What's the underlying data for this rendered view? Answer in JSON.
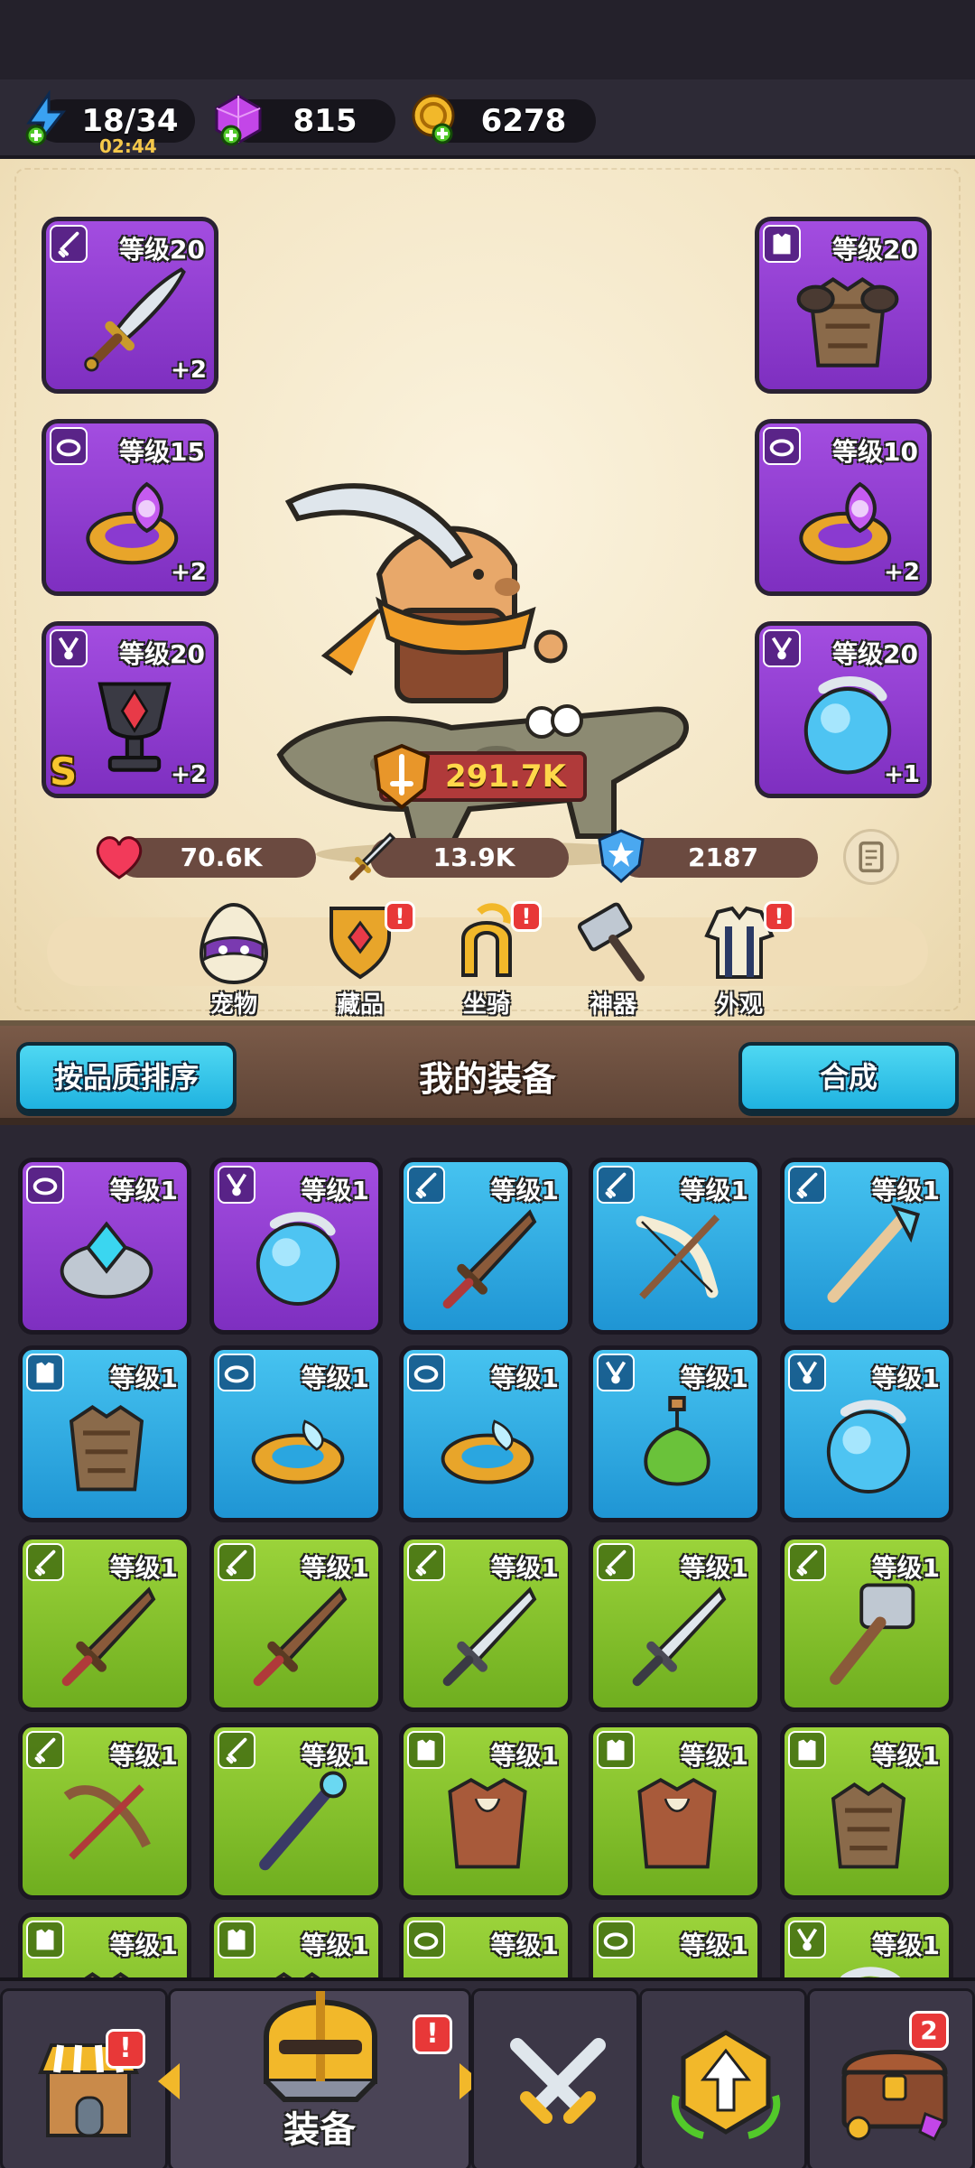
{
  "resources": {
    "energy": {
      "value": "18/34",
      "timer": "02:44",
      "icon": "lightning-plus-icon"
    },
    "gems": {
      "value": "815",
      "icon": "purple-gem-plus-icon"
    },
    "coins": {
      "value": "6278",
      "icon": "gold-coin-plus-icon"
    }
  },
  "equipped": {
    "weapon": {
      "level": "等级20",
      "plus": "+2",
      "quality": "purple",
      "icon": "sword-icon"
    },
    "armor": {
      "level": "等级20",
      "quality": "purple",
      "icon": "armor-icon"
    },
    "ring_left": {
      "level": "等级15",
      "plus": "+2",
      "quality": "purple",
      "icon": "ring-icon"
    },
    "ring_right": {
      "level": "等级10",
      "plus": "+2",
      "quality": "purple",
      "icon": "ring-icon"
    },
    "necklace": {
      "level": "等级20",
      "plus": "+2",
      "rank": "S",
      "quality": "purple",
      "icon": "chalice-icon"
    },
    "amulet": {
      "level": "等级20",
      "plus": "+1",
      "quality": "purple",
      "icon": "orb-icon"
    }
  },
  "power": {
    "value": "291.7K",
    "icon": "power-shield-icon"
  },
  "stats": {
    "hp": {
      "value": "70.6K",
      "icon": "heart-icon"
    },
    "atk": {
      "value": "13.9K",
      "icon": "sword-icon"
    },
    "def": {
      "value": "2187",
      "icon": "shield-icon"
    }
  },
  "features": [
    {
      "label": "宠物",
      "icon": "pet-egg-icon",
      "alert": false
    },
    {
      "label": "藏品",
      "icon": "collection-banner-icon",
      "alert": true
    },
    {
      "label": "坐骑",
      "icon": "mount-horseshoe-icon",
      "alert": true
    },
    {
      "label": "神器",
      "icon": "artifact-hammer-icon",
      "alert": false
    },
    {
      "label": "外观",
      "icon": "outfit-icon",
      "alert": true
    }
  ],
  "alert_mark": "!",
  "inventory": {
    "sort_button": "按品质排序",
    "title": "我的装备",
    "merge_button": "合成",
    "items": [
      {
        "level": "等级1",
        "quality": "purple",
        "type": "ring",
        "icon": "blue-gem-ring-icon"
      },
      {
        "level": "等级1",
        "quality": "purple",
        "type": "necklace",
        "icon": "orb-icon"
      },
      {
        "level": "等级1",
        "quality": "blue",
        "type": "weapon",
        "icon": "wooden-sword-icon"
      },
      {
        "level": "等级1",
        "quality": "blue",
        "type": "weapon",
        "icon": "bone-bow-icon"
      },
      {
        "level": "等级1",
        "quality": "blue",
        "type": "weapon",
        "icon": "crystal-staff-icon"
      },
      {
        "level": "等级1",
        "quality": "blue",
        "type": "armor",
        "icon": "armor-icon"
      },
      {
        "level": "等级1",
        "quality": "blue",
        "type": "ring",
        "icon": "ring-icon"
      },
      {
        "level": "等级1",
        "quality": "blue",
        "type": "ring",
        "icon": "ring-icon"
      },
      {
        "level": "等级1",
        "quality": "blue",
        "type": "necklace",
        "icon": "green-potion-icon"
      },
      {
        "level": "等级1",
        "quality": "blue",
        "type": "necklace",
        "icon": "orb-icon"
      },
      {
        "level": "等级1",
        "quality": "green",
        "type": "weapon",
        "icon": "wooden-sword-icon"
      },
      {
        "level": "等级1",
        "quality": "green",
        "type": "weapon",
        "icon": "wooden-sword-icon"
      },
      {
        "level": "等级1",
        "quality": "green",
        "type": "weapon",
        "icon": "steel-sword-icon"
      },
      {
        "level": "等级1",
        "quality": "green",
        "type": "weapon",
        "icon": "steel-sword-icon"
      },
      {
        "level": "等级1",
        "quality": "green",
        "type": "weapon",
        "icon": "war-hammer-icon"
      },
      {
        "level": "等级1",
        "quality": "green",
        "type": "weapon",
        "icon": "crossbow-icon"
      },
      {
        "level": "等级1",
        "quality": "green",
        "type": "weapon",
        "icon": "magic-staff-icon"
      },
      {
        "level": "等级1",
        "quality": "green",
        "type": "armor",
        "icon": "leather-armor-icon"
      },
      {
        "level": "等级1",
        "quality": "green",
        "type": "armor",
        "icon": "leather-armor-icon"
      },
      {
        "level": "等级1",
        "quality": "green",
        "type": "armor",
        "icon": "armor-icon"
      },
      {
        "level": "等级1",
        "quality": "green",
        "type": "armor",
        "icon": "armor-icon"
      },
      {
        "level": "等级1",
        "quality": "green",
        "type": "armor",
        "icon": "armor-icon"
      },
      {
        "level": "等级1",
        "quality": "green",
        "type": "ring",
        "icon": "ring-icon"
      },
      {
        "level": "等级1",
        "quality": "green",
        "type": "ring",
        "icon": "ring-icon"
      },
      {
        "level": "等级1",
        "quality": "green",
        "type": "necklace",
        "icon": "orb-icon"
      }
    ]
  },
  "nav": {
    "shop": {
      "icon": "shop-icon",
      "alert": "!"
    },
    "equip": {
      "label": "装备",
      "icon": "helmet-icon",
      "alert": "!"
    },
    "battle": {
      "icon": "crossed-swords-icon"
    },
    "upgrade": {
      "icon": "upgrade-arrow-icon"
    },
    "chest": {
      "icon": "treasure-chest-icon",
      "badge": "2"
    }
  },
  "colors": {
    "purple": "#8a3ad0",
    "blue": "#2aa6e0",
    "green": "#82c22a",
    "accent_cyan": "#35c6ea",
    "power_gold": "#ffd84a"
  }
}
